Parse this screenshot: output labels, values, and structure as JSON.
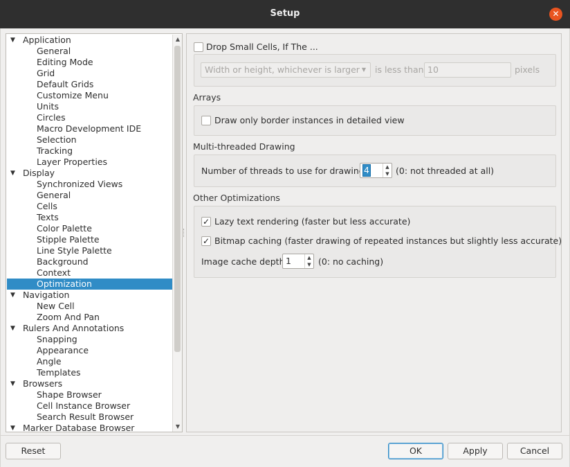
{
  "window": {
    "title": "Setup"
  },
  "tree": {
    "items": [
      {
        "label": "Application",
        "level": 0,
        "expanded": true
      },
      {
        "label": "General",
        "level": 1
      },
      {
        "label": "Editing Mode",
        "level": 1
      },
      {
        "label": "Grid",
        "level": 1
      },
      {
        "label": "Default Grids",
        "level": 1
      },
      {
        "label": "Customize Menu",
        "level": 1
      },
      {
        "label": "Units",
        "level": 1
      },
      {
        "label": "Circles",
        "level": 1
      },
      {
        "label": "Macro Development IDE",
        "level": 1
      },
      {
        "label": "Selection",
        "level": 1
      },
      {
        "label": "Tracking",
        "level": 1
      },
      {
        "label": "Layer Properties",
        "level": 1
      },
      {
        "label": "Display",
        "level": 0,
        "expanded": true
      },
      {
        "label": "Synchronized Views",
        "level": 1
      },
      {
        "label": "General",
        "level": 1
      },
      {
        "label": "Cells",
        "level": 1
      },
      {
        "label": "Texts",
        "level": 1
      },
      {
        "label": "Color Palette",
        "level": 1
      },
      {
        "label": "Stipple Palette",
        "level": 1
      },
      {
        "label": "Line Style Palette",
        "level": 1
      },
      {
        "label": "Background",
        "level": 1
      },
      {
        "label": "Context",
        "level": 1
      },
      {
        "label": "Optimization",
        "level": 1,
        "selected": true
      },
      {
        "label": "Navigation",
        "level": 0,
        "expanded": true
      },
      {
        "label": "New Cell",
        "level": 1
      },
      {
        "label": "Zoom And Pan",
        "level": 1
      },
      {
        "label": "Rulers And Annotations",
        "level": 0,
        "expanded": true
      },
      {
        "label": "Snapping",
        "level": 1
      },
      {
        "label": "Appearance",
        "level": 1
      },
      {
        "label": "Angle",
        "level": 1
      },
      {
        "label": "Templates",
        "level": 1
      },
      {
        "label": "Browsers",
        "level": 0,
        "expanded": true
      },
      {
        "label": "Shape Browser",
        "level": 1
      },
      {
        "label": "Cell Instance Browser",
        "level": 1
      },
      {
        "label": "Search Result Browser",
        "level": 1
      },
      {
        "label": "Marker Database Browser",
        "level": 0,
        "expanded": true
      }
    ]
  },
  "optimization": {
    "drop_small_cells": {
      "label": "Drop Small Cells, If The ...",
      "checked": false,
      "dimension_select": "Width or height, whichever is larger",
      "compare_label": "is less than",
      "threshold_value": "10",
      "unit_label": "pixels"
    },
    "arrays": {
      "heading": "Arrays",
      "border_only_label": "Draw only border instances in detailed view",
      "border_only_checked": false
    },
    "multithreaded": {
      "heading": "Multi-threaded Drawing",
      "threads_label": "Number of threads to use for drawing",
      "threads_value": "4",
      "threads_hint": "(0: not threaded at all)"
    },
    "other": {
      "heading": "Other Optimizations",
      "lazy_text_label": "Lazy text rendering (faster but less accurate)",
      "lazy_text_checked": true,
      "bitmap_cache_label": "Bitmap caching (faster drawing of repeated instances but slightly less accurate)",
      "bitmap_cache_checked": true,
      "cache_depth_label": "Image cache depth",
      "cache_depth_value": "1",
      "cache_depth_hint": "(0: no caching)"
    }
  },
  "buttons": {
    "reset": "Reset",
    "ok": "OK",
    "apply": "Apply",
    "cancel": "Cancel"
  },
  "colors": {
    "selection": "#308cc6",
    "close_button": "#e95420",
    "titlebar": "#2f2f2f"
  }
}
